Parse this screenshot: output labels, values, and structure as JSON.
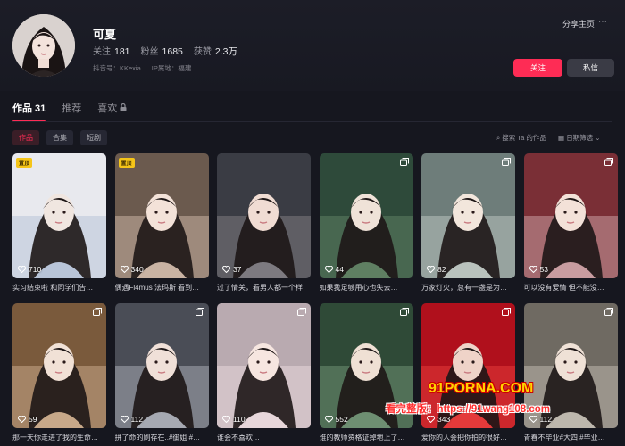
{
  "profile": {
    "name": "可夏",
    "following_label": "关注",
    "following": "181",
    "followers_label": "粉丝",
    "followers": "1685",
    "likes_label": "获赞",
    "likes": "2.3万",
    "douyin_id": "抖音号：KKexia",
    "ip_location": "IP属地：福建",
    "share_label": "分享主页",
    "more_icon": "more-dots-icon",
    "follow_label": "关注",
    "message_label": "私信"
  },
  "tabs": [
    {
      "label": "作品 31",
      "active": true
    },
    {
      "label": "推荐",
      "active": false
    },
    {
      "label": "喜欢",
      "active": false,
      "icon": "lock-icon"
    }
  ],
  "subtabs": [
    {
      "label": "作品",
      "active": true
    },
    {
      "label": "合集",
      "active": false
    },
    {
      "label": "短剧",
      "active": false
    }
  ],
  "search_works": "搜索 Ta 的作品",
  "date_filter": "日期筛选",
  "pin_label": "置顶",
  "videos": [
    {
      "likes": "710",
      "caption": "实习结束啦 和同学们告…",
      "pinned": true,
      "collection": false
    },
    {
      "likes": "340",
      "caption": "偶遇Fl4mus 法玛斯 看到…",
      "pinned": true,
      "collection": false
    },
    {
      "likes": "37",
      "caption": "过了情关，看男人都一个样",
      "pinned": false,
      "collection": false
    },
    {
      "likes": "44",
      "caption": "如果我足够用心也失去…",
      "pinned": false,
      "collection": true
    },
    {
      "likes": "82",
      "caption": "万家灯火，总有一盏是为…",
      "pinned": false,
      "collection": true
    },
    {
      "likes": "53",
      "caption": "可以没有爱情 但不能没…",
      "pinned": false,
      "collection": true
    },
    {
      "likes": "59",
      "caption": "那一天你走进了我的生命…",
      "pinned": false,
      "collection": true
    },
    {
      "likes": "112",
      "caption": "拼了命的刷存在..#御姐 #…",
      "pinned": false,
      "collection": true
    },
    {
      "likes": "110",
      "caption": "谁会不喜欢…",
      "pinned": false,
      "collection": true
    },
    {
      "likes": "552",
      "caption": "谁的教师资格证掉地上了…",
      "pinned": false,
      "collection": true
    },
    {
      "likes": "343",
      "caption": "爱你的人会把你拍的很好…",
      "pinned": false,
      "collection": true
    },
    {
      "likes": "112",
      "caption": "青春不毕业#大四 #毕业…",
      "pinned": false,
      "collection": true
    }
  ],
  "watermarks": {
    "line1": "91PORNA.COM",
    "line2": "看完整版：https://91wang108.com"
  },
  "colors": {
    "accent": "#fe2c55",
    "background": "#16171f",
    "pin": "#f5c518"
  }
}
